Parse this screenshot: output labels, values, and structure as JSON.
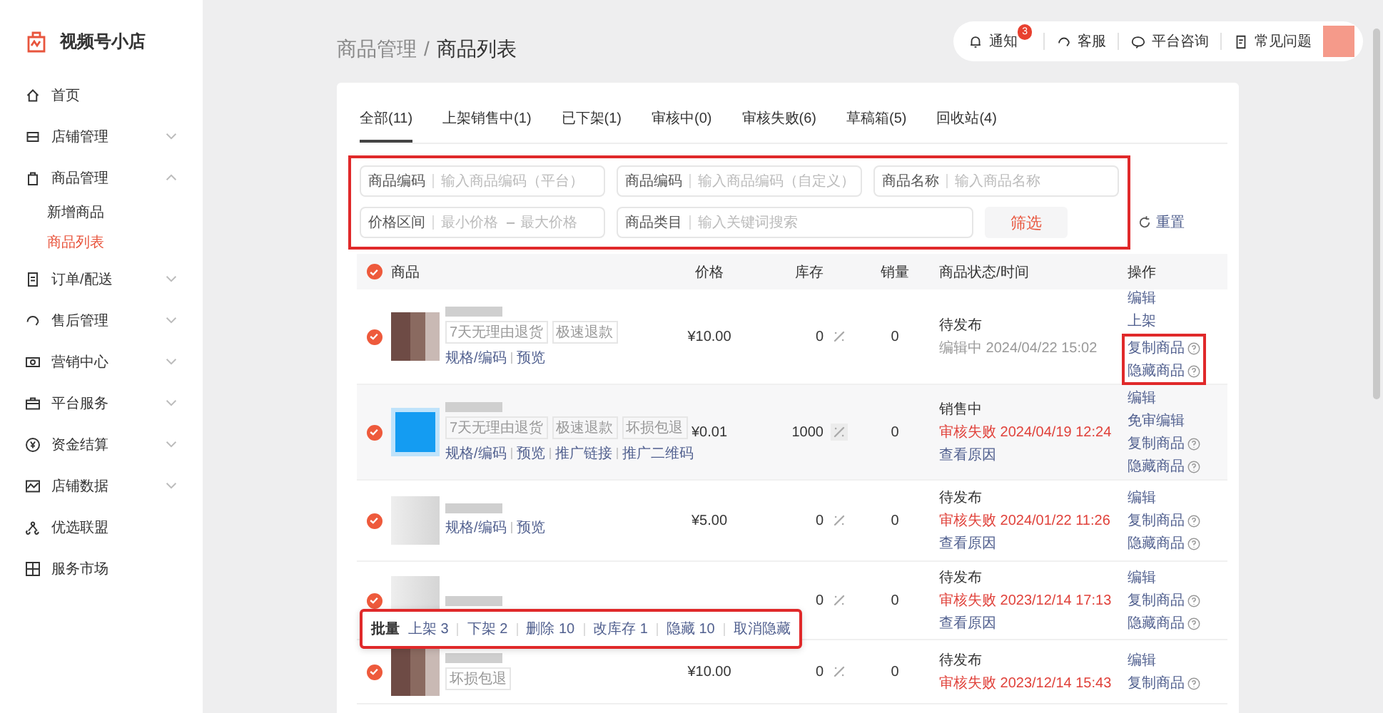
{
  "shop": {
    "name": "视频号小店"
  },
  "sidebar": {
    "items": [
      {
        "label": "首页",
        "expandable": false
      },
      {
        "label": "店铺管理",
        "expandable": true,
        "expanded": false
      },
      {
        "label": "商品管理",
        "expandable": true,
        "expanded": true,
        "children": [
          {
            "label": "新增商品",
            "selected": false
          },
          {
            "label": "商品列表",
            "selected": true
          }
        ]
      },
      {
        "label": "订单/配送",
        "expandable": true,
        "expanded": false
      },
      {
        "label": "售后管理",
        "expandable": true,
        "expanded": false
      },
      {
        "label": "营销中心",
        "expandable": true,
        "expanded": false
      },
      {
        "label": "平台服务",
        "expandable": true,
        "expanded": false
      },
      {
        "label": "资金结算",
        "expandable": true,
        "expanded": false
      },
      {
        "label": "店铺数据",
        "expandable": true,
        "expanded": false
      },
      {
        "label": "优选联盟",
        "expandable": false
      },
      {
        "label": "服务市场",
        "expandable": false
      }
    ]
  },
  "breadcrumb": [
    "商品管理",
    "商品列表"
  ],
  "breadcrumb_separator": "/",
  "topbar": [
    {
      "label": "通知",
      "badge": "3"
    },
    {
      "label": "客服"
    },
    {
      "label": "平台咨询"
    },
    {
      "label": "常见问题"
    }
  ],
  "tabs": [
    {
      "label": "全部(11)",
      "selected": true
    },
    {
      "label": "上架销售中(1)",
      "selected": false
    },
    {
      "label": "已下架(1)",
      "selected": false
    },
    {
      "label": "审核中(0)",
      "selected": false
    },
    {
      "label": "审核失败(6)",
      "selected": false
    },
    {
      "label": "草稿箱(5)",
      "selected": false
    },
    {
      "label": "回收站(4)",
      "selected": false
    }
  ],
  "filters": {
    "highlighted": true,
    "code_platform": {
      "label": "商品编码",
      "placeholder": "输入商品编码（平台）"
    },
    "code_custom": {
      "label": "商品编码",
      "placeholder": "输入商品编码（自定义）"
    },
    "name": {
      "label": "商品名称",
      "placeholder": "输入商品名称"
    },
    "price_range": {
      "label": "价格区间",
      "min_placeholder": "最小价格",
      "separator": "–",
      "max_placeholder": "最大价格"
    },
    "category": {
      "label": "商品类目",
      "placeholder": "输入关键词搜索"
    },
    "filter_button": "筛选",
    "reset": "重置"
  },
  "table": {
    "all_selected": true,
    "columns": [
      "商品",
      "价格",
      "库存",
      "销量",
      "商品状态/时间",
      "操作"
    ],
    "rows": [
      {
        "selected": true,
        "hovered": false,
        "tags": [
          "7天无理由退货",
          "极速退款"
        ],
        "links": [
          "规格/编码",
          "预览"
        ],
        "price": "¥10.00",
        "stock": "0",
        "sales": "0",
        "status": "待发布",
        "status_note": {
          "kind": "editing",
          "text": "编辑中 2024/04/22 15:02"
        },
        "actions": [
          {
            "label": "编辑",
            "help": false
          },
          {
            "label": "上架",
            "help": false
          }
        ],
        "framed_actions": [
          {
            "label": "复制商品",
            "help": true
          },
          {
            "label": "隐藏商品",
            "help": true
          }
        ]
      },
      {
        "selected": true,
        "hovered": true,
        "tags": [
          "7天无理由退货",
          "极速退款",
          "坏损包退"
        ],
        "links": [
          "规格/编码",
          "预览",
          "推广链接",
          "推广二维码"
        ],
        "price": "¥0.01",
        "stock": "1000",
        "sales": "0",
        "status": "销售中",
        "status_note": {
          "kind": "failed",
          "text": "审核失败 2024/04/19 12:24"
        },
        "reason": "查看原因",
        "actions": [
          {
            "label": "编辑",
            "help": false
          },
          {
            "label": "免审编辑",
            "help": false
          },
          {
            "label": "复制商品",
            "help": true
          },
          {
            "label": "隐藏商品",
            "help": true
          }
        ]
      },
      {
        "selected": true,
        "hovered": false,
        "links": [
          "规格/编码",
          "预览"
        ],
        "price": "¥5.00",
        "stock": "0",
        "sales": "0",
        "status": "待发布",
        "status_note": {
          "kind": "failed",
          "text": "审核失败 2024/01/22 11:26"
        },
        "reason": "查看原因",
        "actions": [
          {
            "label": "编辑",
            "help": false
          },
          {
            "label": "复制商品",
            "help": true
          },
          {
            "label": "隐藏商品",
            "help": true
          }
        ]
      },
      {
        "selected": true,
        "hovered": false,
        "stock": "0",
        "sales": "0",
        "status": "待发布",
        "status_note": {
          "kind": "failed",
          "text": "审核失败 2023/12/14 17:13"
        },
        "reason": "查看原因",
        "actions": [
          {
            "label": "编辑",
            "help": false
          },
          {
            "label": "复制商品",
            "help": true
          },
          {
            "label": "隐藏商品",
            "help": true
          }
        ]
      },
      {
        "selected": true,
        "hovered": false,
        "tags": [
          "坏损包退"
        ],
        "price": "¥10.00",
        "stock": "0",
        "sales": "0",
        "status": "待发布",
        "status_note": {
          "kind": "failed",
          "text": "审核失败 2023/12/14 15:43"
        },
        "actions": [
          {
            "label": "编辑",
            "help": false
          },
          {
            "label": "复制商品",
            "help": true
          }
        ]
      }
    ]
  },
  "batch_bar": {
    "highlighted": true,
    "label": "批量",
    "items": [
      "上架 3",
      "下架 2",
      "删除 10",
      "改库存 1",
      "隐藏 10",
      "取消隐藏"
    ]
  }
}
